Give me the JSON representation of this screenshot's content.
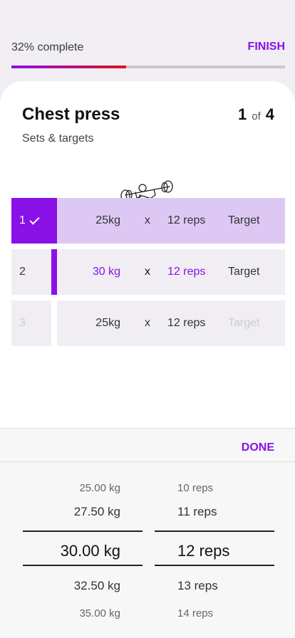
{
  "header": {
    "progress_text": "32% complete",
    "progress_value": 0.42,
    "finish_label": "FINISH"
  },
  "exercise": {
    "title": "Chest press",
    "subtitle": "Sets & targets",
    "current": "1",
    "of_label": "of",
    "total": "4"
  },
  "sets": [
    {
      "number": "1",
      "weight": "25kg",
      "x": "x",
      "reps": "12 reps",
      "target": "Target"
    },
    {
      "number": "2",
      "weight": "30 kg",
      "x": "x",
      "reps": "12 reps",
      "target": "Target"
    },
    {
      "number": "3",
      "weight": "25kg",
      "x": "x",
      "reps": "12 reps",
      "target": "Target"
    }
  ],
  "picker": {
    "done_label": "DONE",
    "weights": [
      "25.00 kg",
      "27.50 kg",
      "30.00 kg",
      "32.50 kg",
      "35.00 kg"
    ],
    "reps": [
      "10 reps",
      "11 reps",
      "12 reps",
      "13 reps",
      "14 reps"
    ]
  },
  "colors": {
    "accent": "#8a10e8",
    "progress_end": "#e01022",
    "row_complete": "#ddc8f4"
  }
}
